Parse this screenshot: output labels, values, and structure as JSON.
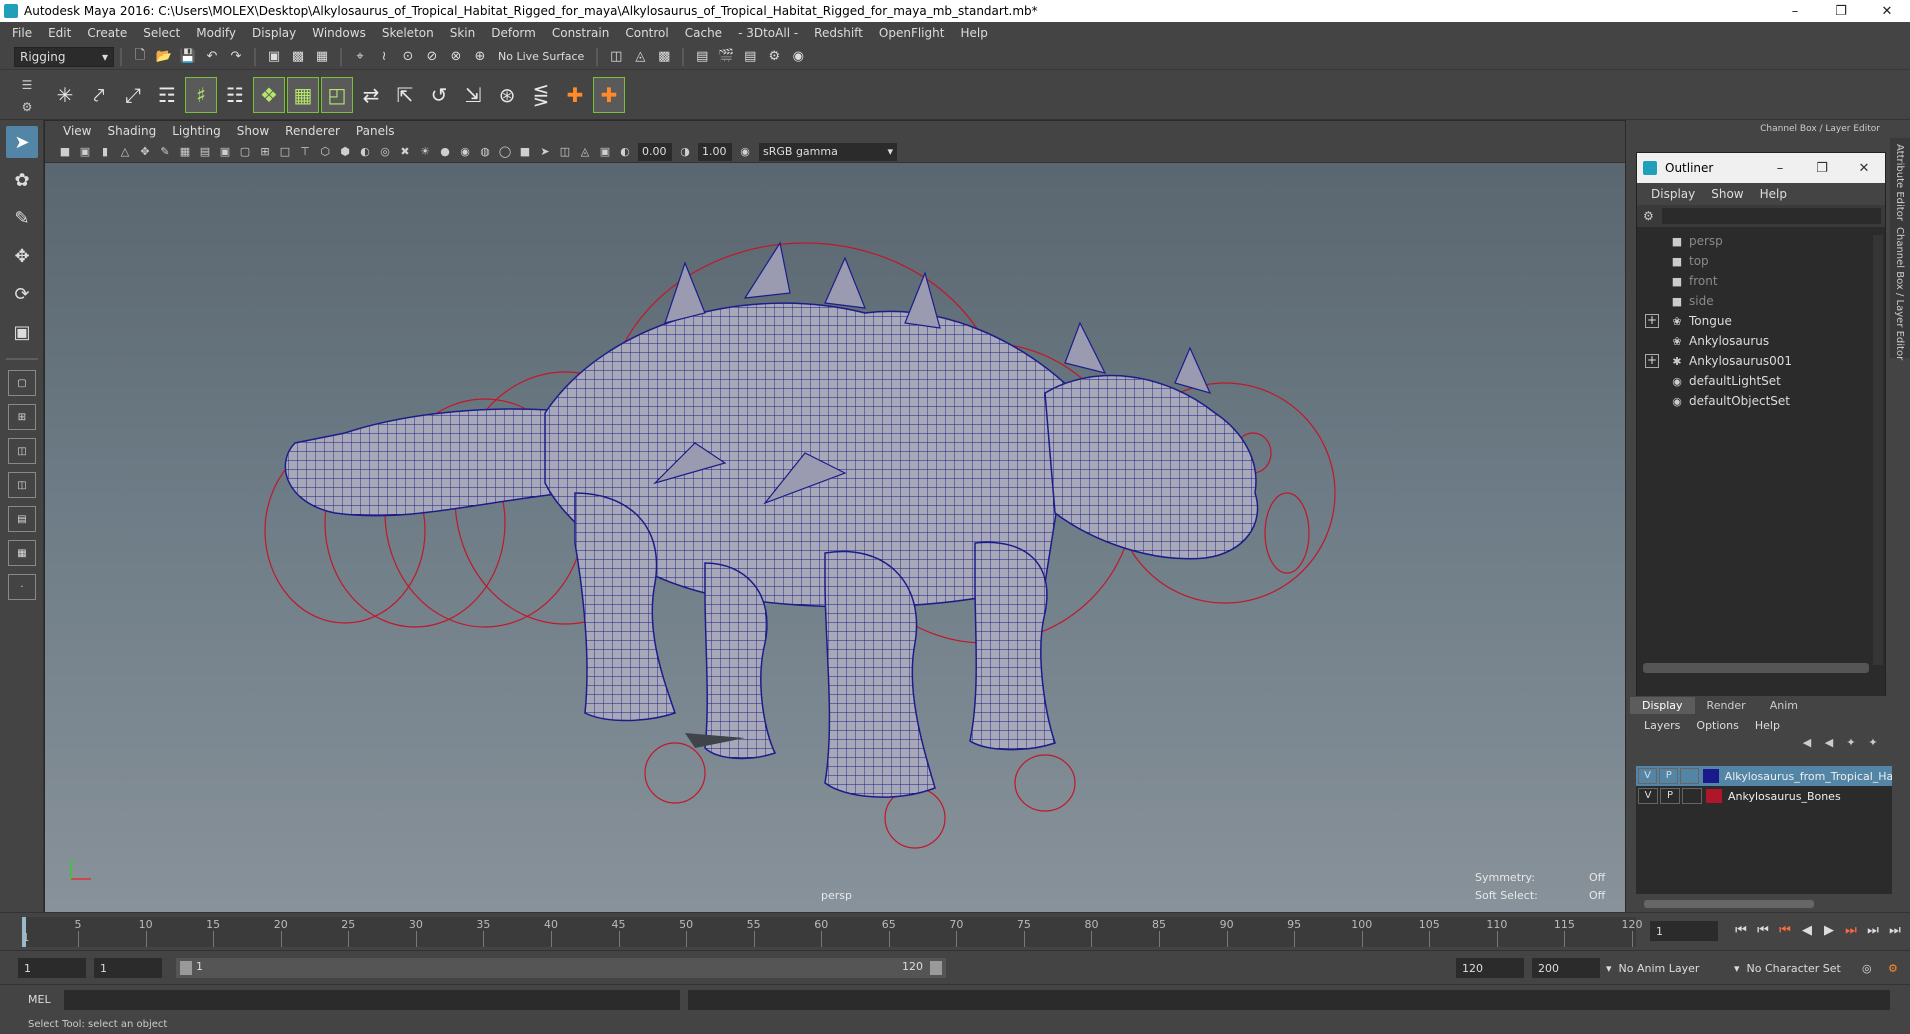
{
  "window": {
    "title": "Autodesk Maya 2016: C:\\Users\\MOLEX\\Desktop\\Alkylosaurus_of_Tropical_Habitat_Rigged_for_maya\\Alkylosaurus_of_Tropical_Habitat_Rigged_for_maya_mb_standart.mb*",
    "minimize": "–",
    "restore": "❐",
    "close": "✕"
  },
  "menus": [
    "File",
    "Edit",
    "Create",
    "Select",
    "Modify",
    "Display",
    "Windows",
    "Skeleton",
    "Skin",
    "Deform",
    "Constrain",
    "Control",
    "Cache",
    "- 3DtoAll -",
    "Redshift",
    "OpenFlight",
    "Help"
  ],
  "status_line": {
    "mode": "Rigging",
    "live_surface": "No Live Surface"
  },
  "viewport": {
    "menus": [
      "View",
      "Shading",
      "Lighting",
      "Show",
      "Renderer",
      "Panels"
    ],
    "near_value": "0.00",
    "far_value": "1.00",
    "color_space": "sRGB gamma",
    "camera_label": "persp",
    "symmetry_label": "Symmetry:",
    "symmetry_value": "Off",
    "soft_select_label": "Soft Select:",
    "soft_select_value": "Off"
  },
  "channel_box": {
    "title": "Channel Box / Layer Editor",
    "side_tabs": [
      "Attribute Editor",
      "Channel Box / Layer Editor"
    ]
  },
  "outliner": {
    "title": "Outliner",
    "menus": [
      "Display",
      "Show",
      "Help"
    ],
    "items": [
      {
        "label": "persp",
        "icon": "camera-icon",
        "expandable": false,
        "dim": true
      },
      {
        "label": "top",
        "icon": "camera-icon",
        "expandable": false,
        "dim": true
      },
      {
        "label": "front",
        "icon": "camera-icon",
        "expandable": false,
        "dim": true
      },
      {
        "label": "side",
        "icon": "camera-icon",
        "expandable": false,
        "dim": true
      },
      {
        "label": "Tongue",
        "icon": "mesh-icon",
        "expandable": true,
        "dim": false
      },
      {
        "label": "Ankylosaurus",
        "icon": "mesh-icon",
        "expandable": false,
        "dim": false
      },
      {
        "label": "Ankylosaurus001",
        "icon": "joint-icon",
        "expandable": true,
        "dim": false
      },
      {
        "label": "defaultLightSet",
        "icon": "set-icon",
        "expandable": false,
        "dim": false
      },
      {
        "label": "defaultObjectSet",
        "icon": "set-icon",
        "expandable": false,
        "dim": false
      }
    ]
  },
  "layer_editor": {
    "tabs": [
      "Display",
      "Render",
      "Anim"
    ],
    "menus": [
      "Layers",
      "Options",
      "Help"
    ],
    "layers": [
      {
        "v": "V",
        "p": "P",
        "name": "Alkylosaurus_from_Tropical_Hab",
        "color": "#1a1a8c",
        "selected": true
      },
      {
        "v": "V",
        "p": "P",
        "name": "Ankylosaurus_Bones",
        "color": "#b0162a",
        "selected": false
      }
    ]
  },
  "time_slider": {
    "ticks": [
      "5",
      "10",
      "15",
      "20",
      "25",
      "30",
      "35",
      "40",
      "45",
      "50",
      "55",
      "60",
      "65",
      "70",
      "75",
      "80",
      "85",
      "90",
      "95",
      "100",
      "105",
      "110",
      "115",
      "120"
    ],
    "first_tick": "1",
    "current_frame": "1"
  },
  "range": {
    "start": "1",
    "playback_start": "1",
    "slider_start": "1",
    "slider_end": "120",
    "playback_end": "120",
    "end": "200",
    "anim_layer": "No Anim Layer",
    "character_set": "No Character Set"
  },
  "command_line": {
    "language": "MEL"
  },
  "help_line": "Select Tool: select an object",
  "colors": {
    "wire": "#1c1c8a",
    "rig": "#c0182a",
    "selection": "#5285a6"
  }
}
